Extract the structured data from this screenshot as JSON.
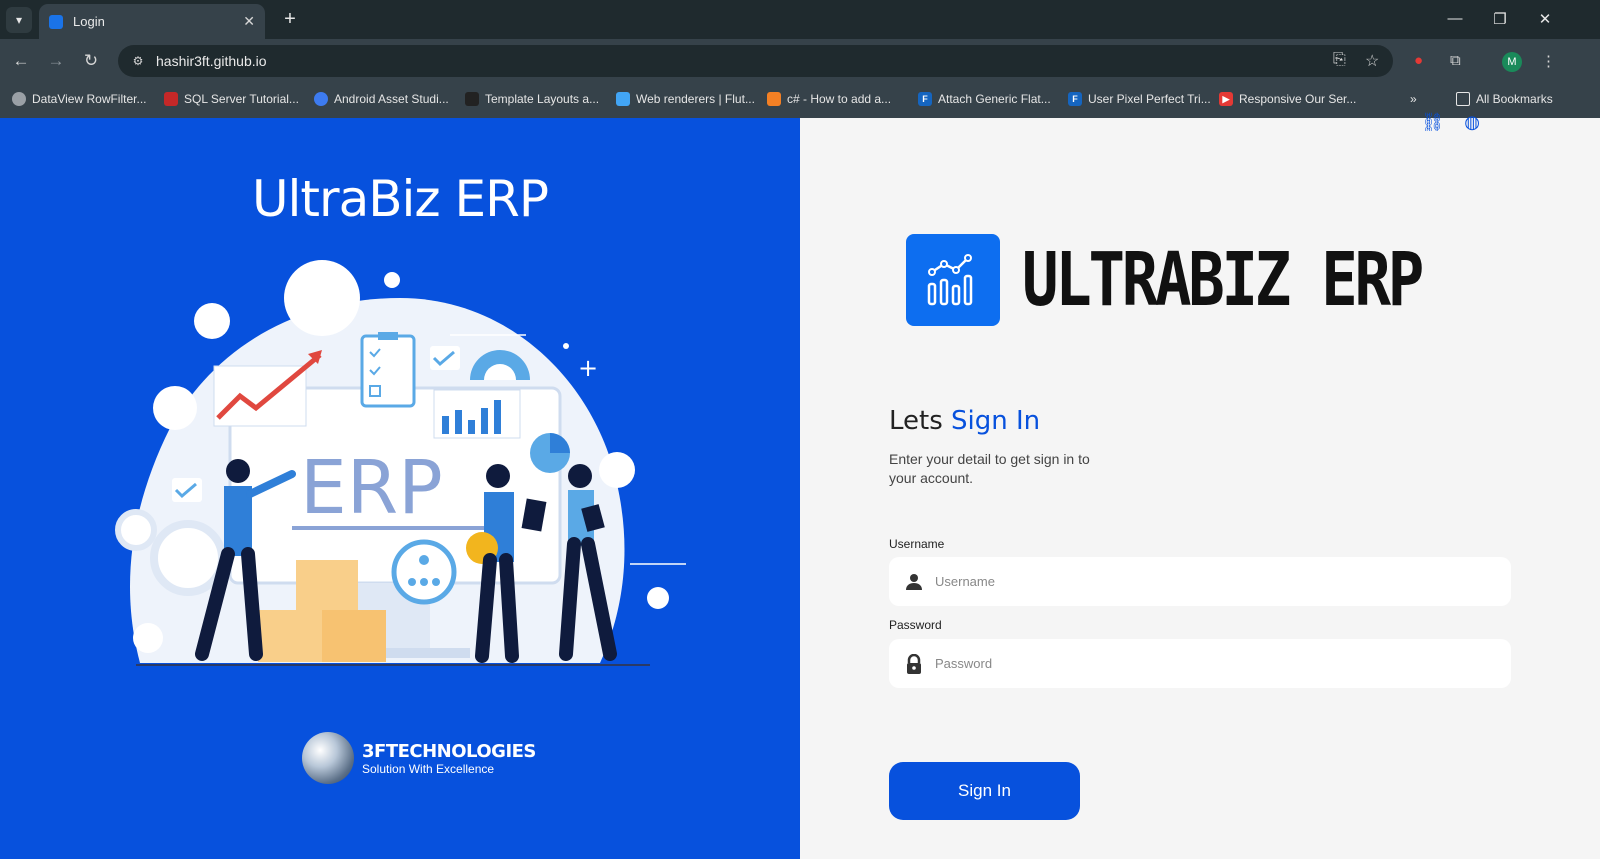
{
  "browser": {
    "tab_title": "Login",
    "url": "hashir3ft.github.io",
    "avatar_letter": "M",
    "bookmarks": [
      {
        "label": "DataView RowFilter...",
        "color": "#9aa0a6"
      },
      {
        "label": "SQL Server Tutorial...",
        "color": "#c62828"
      },
      {
        "label": "Android Asset Studi...",
        "color": "#3d7bf0"
      },
      {
        "label": "Template Layouts a...",
        "color": "#222222"
      },
      {
        "label": "Web renderers | Flut...",
        "color": "#42a5f5"
      },
      {
        "label": "c# - How to add a...",
        "color": "#f48024"
      },
      {
        "label": "Attach Generic Flat...",
        "color": "#1565c0"
      },
      {
        "label": "User Pixel Perfect Tri...",
        "color": "#1565c0"
      },
      {
        "label": "Responsive Our Ser...",
        "color": "#e53935"
      }
    ],
    "all_bookmarks": "All Bookmarks"
  },
  "left": {
    "title": "UltraBiz ERP",
    "illustration_text": "ERP",
    "partner_name": "3FTECHNOLOGIES",
    "partner_tagline": "Solution With Excellence"
  },
  "right": {
    "logo_text": "ULTRABIZ ERP",
    "heading_prefix": "Lets ",
    "heading_accent": "Sign In",
    "subtitle": "Enter your detail to get sign in to your account.",
    "username_label": "Username",
    "username_placeholder": "Username",
    "password_label": "Password",
    "password_placeholder": "Password",
    "signin_button": "Sign In"
  },
  "colors": {
    "brand_blue": "#0751dd",
    "panel_bg": "#f5f5f5"
  }
}
